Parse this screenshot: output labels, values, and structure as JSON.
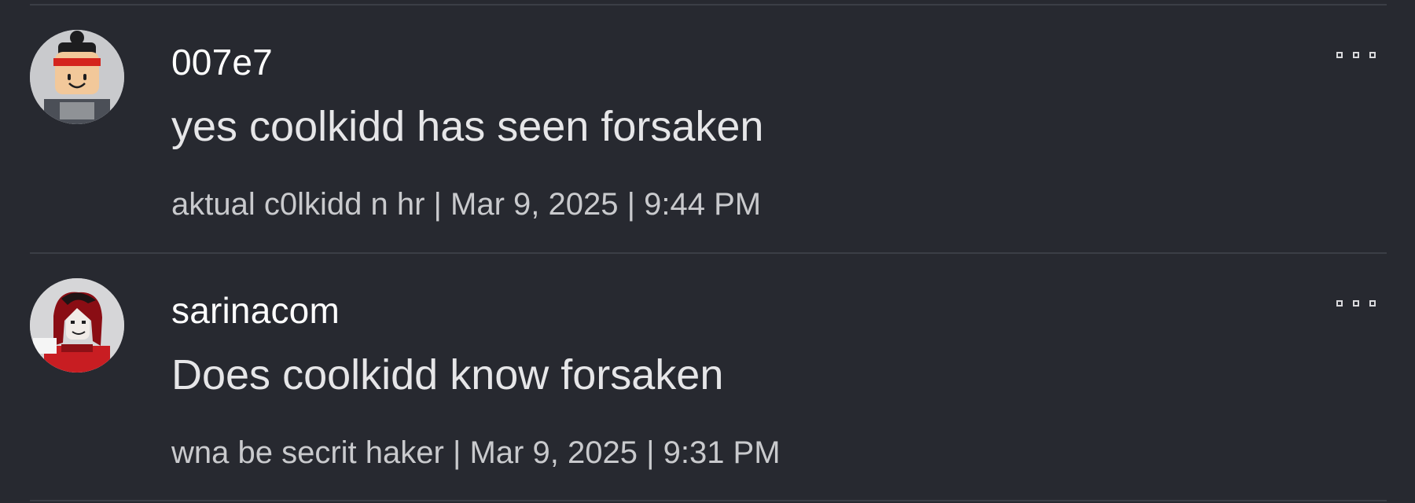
{
  "comments": [
    {
      "username": "007e7",
      "text": "yes coolkidd has seen forsaken",
      "meta": {
        "display_name": "aktual c0lkidd n hr",
        "separator": "|",
        "date": "Mar 9, 2025",
        "time": "9:44 PM"
      },
      "avatar_icon": "roblox-avatar-red-headband-icon"
    },
    {
      "username": "sarinacom",
      "text": "Does coolkidd know forsaken",
      "meta": {
        "display_name": "wna be secrit haker",
        "separator": "|",
        "date": "Mar 9, 2025",
        "time": "9:31 PM"
      },
      "avatar_icon": "roblox-avatar-red-hair-icon"
    }
  ],
  "more_options_icon": "ellipsis-icon",
  "colors": {
    "background": "#272930",
    "divider": "#3b3e46",
    "username": "#ffffff",
    "text": "#e6e6e8",
    "meta": "#c9cacd"
  }
}
